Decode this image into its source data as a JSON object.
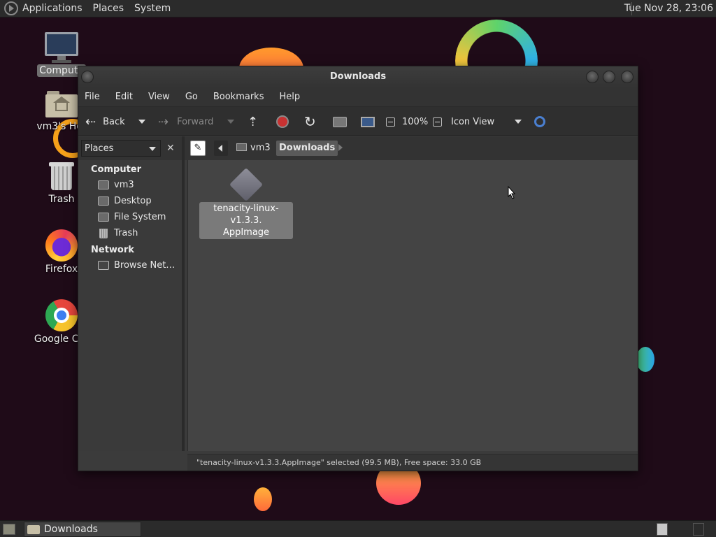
{
  "top_panel": {
    "menus": [
      "Applications",
      "Places",
      "System"
    ],
    "clock": "Tue Nov 28, 23:06"
  },
  "desktop": {
    "icons": [
      {
        "label": "Compute",
        "icon": "computer-icon",
        "selected": true
      },
      {
        "label": "vm3's Hor",
        "icon": "home-folder-icon"
      },
      {
        "label": "Trash",
        "icon": "trash-icon"
      },
      {
        "label": "Firefox",
        "icon": "firefox-icon"
      },
      {
        "label": "Google Chr",
        "icon": "chrome-icon"
      }
    ]
  },
  "window": {
    "title": "Downloads",
    "menus": [
      "File",
      "Edit",
      "View",
      "Go",
      "Bookmarks",
      "Help"
    ],
    "toolbar": {
      "back": "Back",
      "forward": "Forward",
      "zoom": "100%",
      "view_mode": "Icon View"
    },
    "sidebar": {
      "selector": "Places",
      "groups": [
        {
          "title": "Computer",
          "items": [
            "vm3",
            "Desktop",
            "File System",
            "Trash"
          ]
        },
        {
          "title": "Network",
          "items": [
            "Browse Net…"
          ]
        }
      ]
    },
    "path": [
      "vm3",
      "Downloads"
    ],
    "files": [
      {
        "name": "tenacity-linux-v1.3.3.AppImage",
        "label_line1": "tenacity-linux-v1.3.3.",
        "label_line2": "AppImage",
        "selected": true
      }
    ],
    "status": "\"tenacity-linux-v1.3.3.AppImage\" selected (99.5 MB), Free space: 33.0 GB"
  },
  "bottom_panel": {
    "task": "Downloads"
  }
}
